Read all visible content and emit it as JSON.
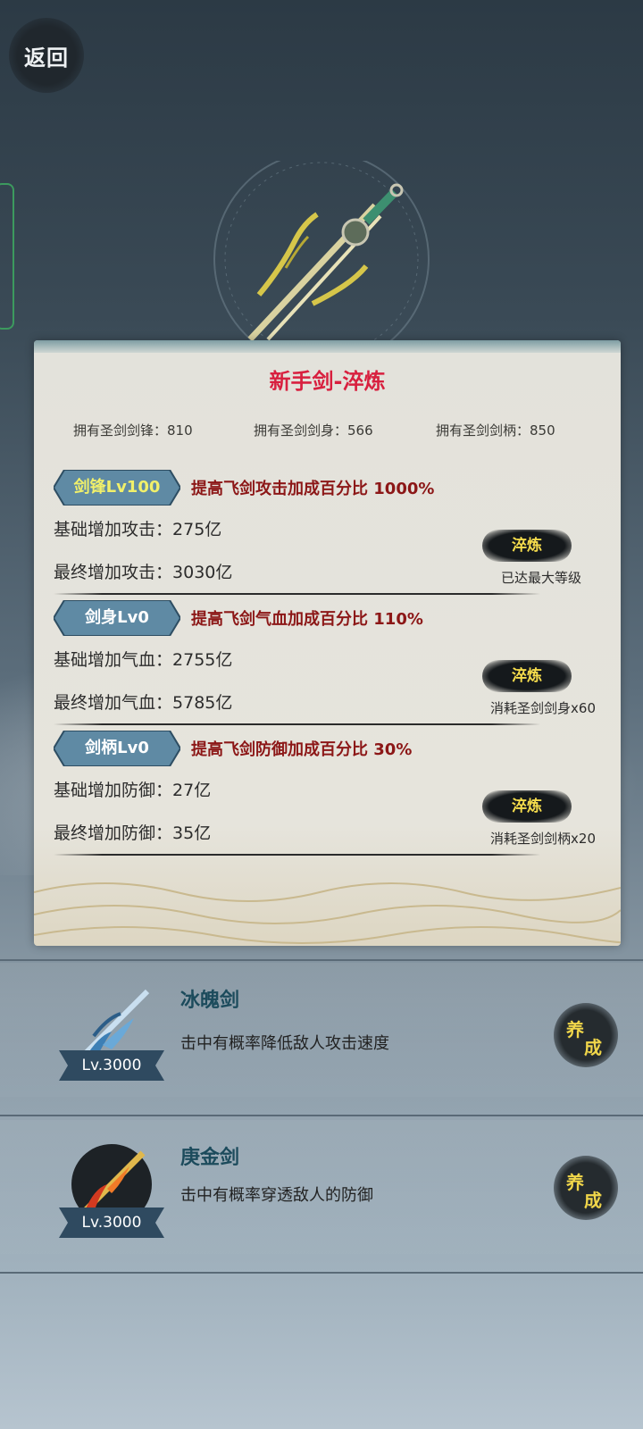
{
  "header": {
    "back_label": "返回"
  },
  "panel": {
    "title": "新手剑-淬炼",
    "owned": [
      {
        "label": "拥有圣剑剑锋：",
        "value": "810"
      },
      {
        "label": "拥有圣剑剑身：",
        "value": "566"
      },
      {
        "label": "拥有圣剑剑柄：",
        "value": "850"
      }
    ],
    "stats": [
      {
        "tag": "剑锋Lv100",
        "tag_color": "#f1f06a",
        "desc": "提高飞剑攻击加成百分比 1000%",
        "base_label": "基础增加攻击：",
        "base_value": "275亿",
        "final_label": "最终增加攻击：",
        "final_value": "3030亿",
        "button": "淬炼",
        "cost": "已达最大等级"
      },
      {
        "tag": "剑身Lv0",
        "tag_color": "#ffffff",
        "desc": "提高飞剑气血加成百分比 110%",
        "base_label": "基础增加气血：",
        "base_value": "2755亿",
        "final_label": "最终增加气血：",
        "final_value": "5785亿",
        "button": "淬炼",
        "cost": "消耗圣剑剑身x60"
      },
      {
        "tag": "剑柄Lv0",
        "tag_color": "#ffffff",
        "desc": "提高飞剑防御加成百分比 30%",
        "base_label": "基础增加防御：",
        "base_value": "27亿",
        "final_label": "最终增加防御：",
        "final_value": "35亿",
        "button": "淬炼",
        "cost": "消耗圣剑剑柄x20"
      }
    ]
  },
  "swords": [
    {
      "name": "冰魄剑",
      "desc": "击中有概率降低敌人攻击速度",
      "level": "Lv.3000",
      "button_a": "养",
      "button_b": "成",
      "icon": "ice-sword-icon"
    },
    {
      "name": "庚金剑",
      "desc": "击中有概率穿透敌人的防御",
      "level": "Lv.3000",
      "button_a": "养",
      "button_b": "成",
      "icon": "fire-sword-icon"
    }
  ],
  "colors": {
    "title_red": "#d8203f",
    "desc_red": "#8c1717",
    "button_yellow": "#f5dc4c",
    "tag_blue": "#5f8aa4"
  }
}
